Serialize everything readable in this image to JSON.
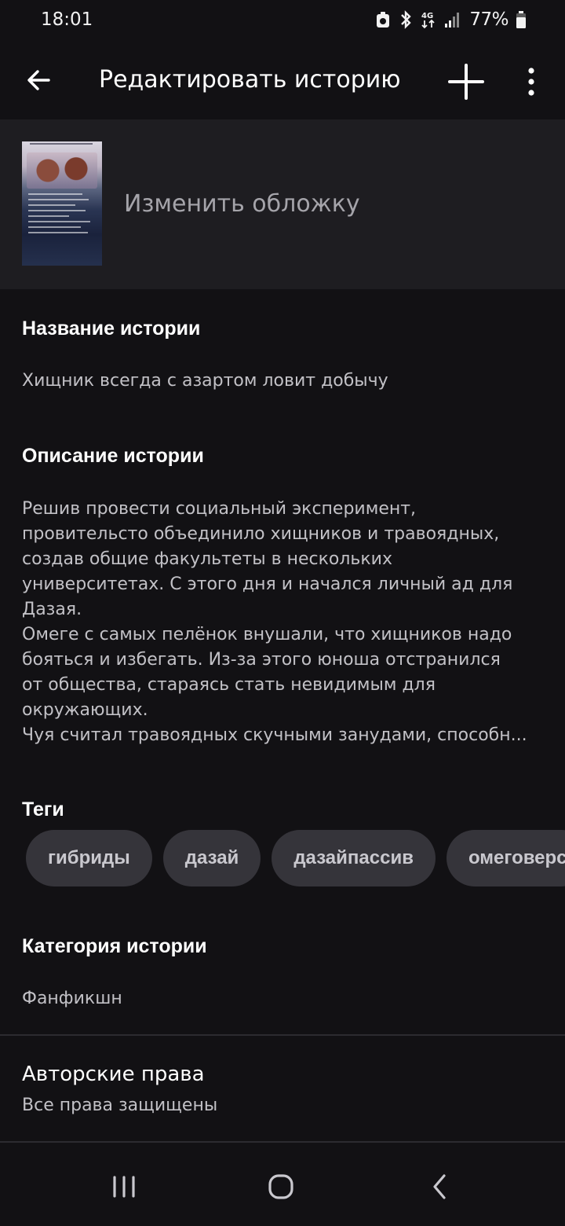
{
  "status_bar": {
    "time": "18:01",
    "battery": "77%",
    "network": "4G"
  },
  "app_bar": {
    "title": "Редактировать историю",
    "back_icon": "arrow-left-icon",
    "add_icon": "plus-icon",
    "more_icon": "more-vertical-icon"
  },
  "cover": {
    "change_label": "Изменить обложку"
  },
  "story_title": {
    "label": "Название истории",
    "value": "Хищник всегда с азартом ловит добычу"
  },
  "story_description": {
    "label": "Описание истории",
    "value": "Решив провести социальный эксперимент,\nпровительсто объединило хищников и травоядных,\nсоздав общие факультеты в нескольких\nуниверситетах. С этого дня и начался личный ад для\nДазая.\nОмеге с самых пелёнок внушали, что хищников надо\nбояться и избегать. Из-за этого юноша отстранился\nот общества, стараясь стать невидимым для\nокружающих.\nЧуя считал травоядных скучными занудами, способн..."
  },
  "tags": {
    "label": "Теги",
    "items": [
      "гибриды",
      "дазай",
      "дазайпассив",
      "омеговерс"
    ]
  },
  "category": {
    "label": "Категория истории",
    "value": "Фанфикшн"
  },
  "copyright": {
    "label": "Авторские права",
    "value": "Все права защищены"
  },
  "nav_bar": {
    "recents_icon": "recents-icon",
    "home_icon": "home-icon",
    "back_icon": "back-chevron-icon"
  },
  "colors": {
    "background": "#121114",
    "cover_section": "#1e1d21",
    "chip": "#35343a",
    "muted_text": "#c2c1c6"
  }
}
